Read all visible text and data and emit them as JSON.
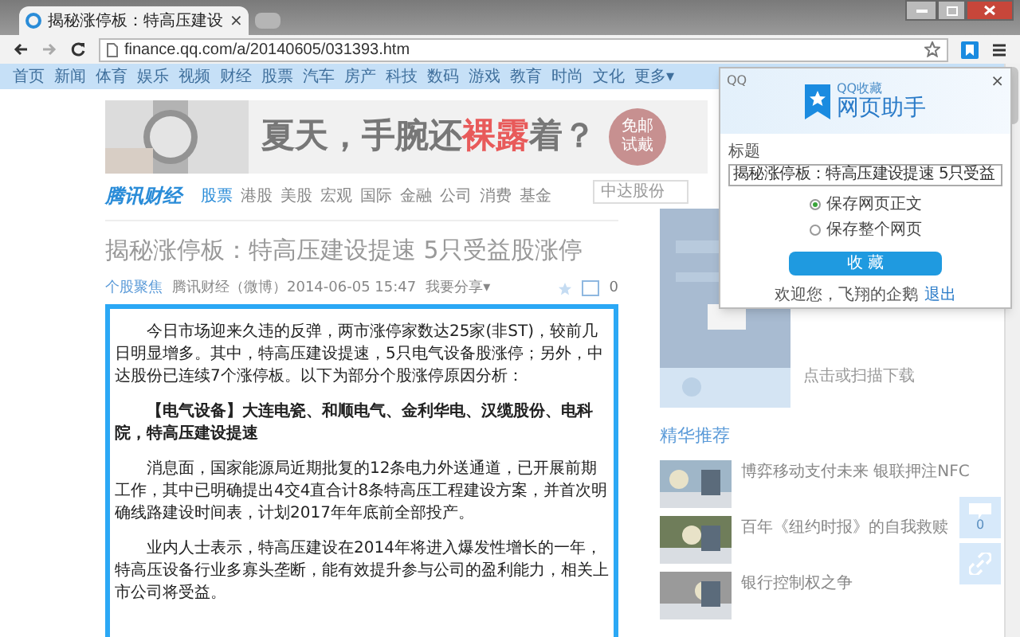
{
  "browser": {
    "tabs": [
      {
        "title": "揭秘涨停板：特高压建设",
        "close": "×",
        "selected": true
      }
    ],
    "address": "finance.qq.com/a/20140605/031393.htm"
  },
  "top_nav": {
    "items": [
      "首页",
      "新闻",
      "体育",
      "娱乐",
      "视频",
      "财经",
      "股票",
      "汽车",
      "房产",
      "科技",
      "数码",
      "游戏",
      "教育",
      "时尚",
      "文化"
    ],
    "more": "更多▾"
  },
  "ad": {
    "parts": [
      {
        "text": "夏天，手腕还",
        "highlight": false
      },
      {
        "text": "裸露",
        "highlight": true
      },
      {
        "text": "着？",
        "highlight": false
      }
    ],
    "badge": "免邮试戴"
  },
  "site": {
    "logo": "腾讯财经",
    "nav": [
      {
        "label": "股票",
        "selected": true
      },
      {
        "label": "港股",
        "selected": false
      },
      {
        "label": "美股",
        "selected": false
      },
      {
        "label": "宏观",
        "selected": false
      },
      {
        "label": "国际",
        "selected": false
      },
      {
        "label": "金融",
        "selected": false
      },
      {
        "label": "公司",
        "selected": false
      },
      {
        "label": "消费",
        "selected": false
      },
      {
        "label": "基金",
        "selected": false
      }
    ],
    "search": {
      "placeholder": "中达股份"
    }
  },
  "article": {
    "title": "揭秘涨停板：特高压建设提速 5只受益股涨停",
    "meta": {
      "tag": "个股聚焦",
      "source": "腾讯财经（微博）2014-06-05 15:47",
      "share": "我要分享▾",
      "count": "0"
    },
    "paragraphs": [
      {
        "text": "今日市场迎来久违的反弹，两市涨停家数达25家(非ST)，较前几日明显增多。其中，特高压建设提速，5只电气设备股涨停；另外，中达股份已连续7个涨停板。以下为部分个股涨停原因分析：",
        "bold": false
      },
      {
        "text": "【电气设备】大连电瓷、和顺电气、金利华电、汉缆股份、电科院，特高压建设提速",
        "bold": true
      },
      {
        "text": "消息面，国家能源局近期批复的12条电力外送通道，已开展前期工作，其中已明确提出4交4直合计8条特高压工程建设方案，并首次明确线路建设时间表，计划2017年年底前全部投产。",
        "bold": false
      },
      {
        "text": "业内人士表示，特高压建设在2014年将进入爆发性增长的一年，特高压设备行业多寡头垄断，能有效提升参与公司的盈利能力，相关上市公司将受益。",
        "bold": false
      }
    ]
  },
  "sidebar": {
    "qr_caption": "点击或扫描下载",
    "section_title": "精华推荐",
    "items": [
      "博弈移动支付未来 银联押注NFC",
      "百年《纽约时报》的自我救赎",
      "银行控制权之争"
    ],
    "comment_count": "0"
  },
  "popup": {
    "account": "QQ",
    "close": "×",
    "brand_small": "QQ收藏",
    "brand": "网页助手",
    "field_label": "标题",
    "field_value": "揭秘涨停板：特高压建设提速 5只受益",
    "options": [
      {
        "label": "保存网页正文",
        "selected": true
      },
      {
        "label": "保存整个网页",
        "selected": false
      }
    ],
    "button": "收 藏",
    "welcome": "欢迎您，飞翔的企鹅",
    "logout": "退出"
  }
}
